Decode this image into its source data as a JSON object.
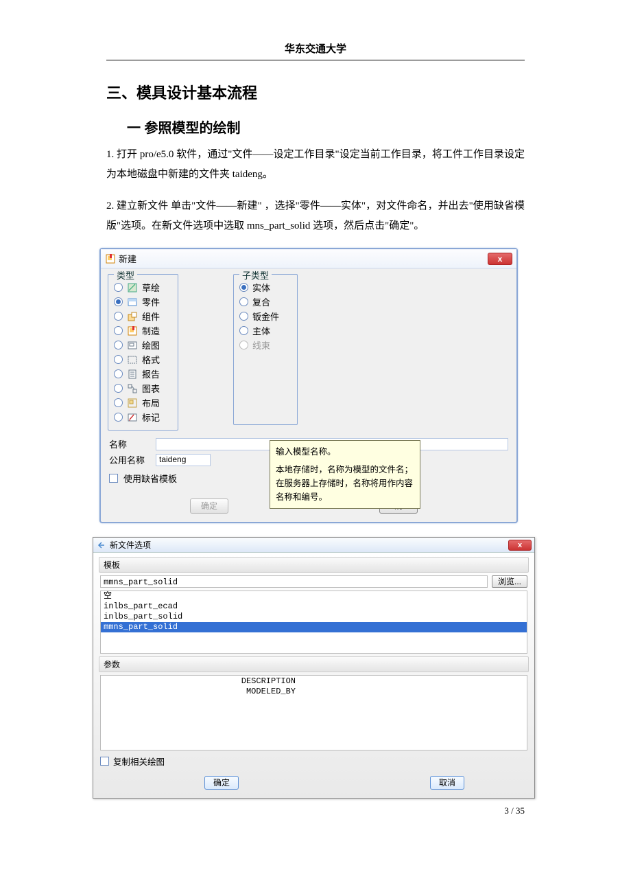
{
  "header": "华东交通大学",
  "heading_main": "三、模具设计基本流程",
  "heading_sub": "一  参照模型的绘制",
  "para1": "1.   打开 pro/e5.0 软件，通过\"文件——设定工作目录\"设定当前工作目录，将工件工作目录设定为本地磁盘中新建的文件夹 taideng。",
  "para2": "2.   建立新文件     单击\"文件——新建\" ，选择\"零件——实体\"，对文件命名，并出去\"使用缺省模版\"选项。在新文件选项中选取 mns_part_solid 选项，然后点击\"确定\"。",
  "dialog1": {
    "title": "新建",
    "close": "x",
    "type_legend": "类型",
    "subtype_legend": "子类型",
    "types": [
      {
        "label": "草绘",
        "key": "sketch"
      },
      {
        "label": "零件",
        "key": "part"
      },
      {
        "label": "组件",
        "key": "assembly"
      },
      {
        "label": "制造",
        "key": "mfg"
      },
      {
        "label": "绘图",
        "key": "drawing"
      },
      {
        "label": "格式",
        "key": "format"
      },
      {
        "label": "报告",
        "key": "report"
      },
      {
        "label": "图表",
        "key": "diagram"
      },
      {
        "label": "布局",
        "key": "layout"
      },
      {
        "label": "标记",
        "key": "markup"
      }
    ],
    "type_selected": "零件",
    "subtypes": [
      {
        "label": "实体",
        "enabled": true
      },
      {
        "label": "复合",
        "enabled": true
      },
      {
        "label": "钣金件",
        "enabled": true
      },
      {
        "label": "主体",
        "enabled": true
      },
      {
        "label": "线束",
        "enabled": false
      }
    ],
    "subtype_selected": "实体",
    "name_label": "名称",
    "common_name_label": "公用名称",
    "common_name_value": "taideng",
    "use_default_template": "使用缺省模板",
    "ok": "确定",
    "cancel": "消",
    "tooltip_line1": "输入模型名称。",
    "tooltip_line2": "本地存储时，名称为模型的文件名；",
    "tooltip_line3": "在服务器上存储时，名称将用作内容名称和编号。"
  },
  "dialog2": {
    "title": "新文件选项",
    "close": "x",
    "template_section": "模板",
    "template_value": "mmns_part_solid",
    "browse": "浏览...",
    "template_list": [
      "空",
      "inlbs_part_ecad",
      "inlbs_part_solid",
      "mmns_part_solid"
    ],
    "template_selected": "mmns_part_solid",
    "params_section": "参数",
    "params": [
      {
        "label": "DESCRIPTION",
        "value": ""
      },
      {
        "label": "MODELED_BY",
        "value": ""
      }
    ],
    "copy_related": "复制相关绘图",
    "ok": "确定",
    "cancel": "取消"
  },
  "page_number": "3 / 35"
}
